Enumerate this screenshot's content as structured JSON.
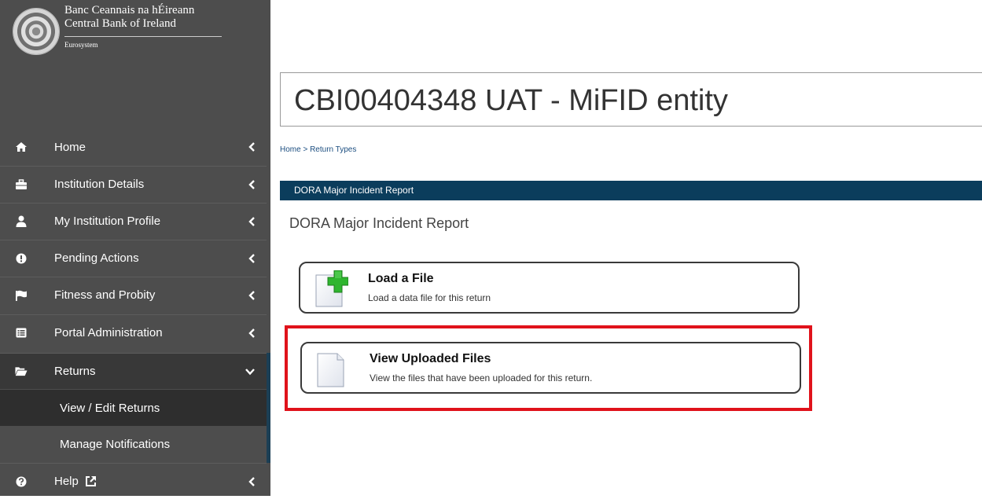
{
  "logo": {
    "irish_name": "Banc Ceannais na hÉireann",
    "english_name": "Central Bank of Ireland",
    "tagline": "Eurosystem"
  },
  "sidebar": {
    "items": [
      {
        "label": "Home",
        "icon": "home-icon"
      },
      {
        "label": "Institution Details",
        "icon": "briefcase-icon"
      },
      {
        "label": "My Institution Profile",
        "icon": "user-icon"
      },
      {
        "label": "Pending Actions",
        "icon": "exclamation-circle-icon"
      },
      {
        "label": "Fitness and Probity",
        "icon": "flag-icon"
      },
      {
        "label": "Portal Administration",
        "icon": "list-card-icon"
      },
      {
        "label": "Returns",
        "icon": "folder-open-icon"
      },
      {
        "label": "Help",
        "icon": "question-circle-icon"
      }
    ],
    "returns_subitems": [
      {
        "label": "View / Edit Returns"
      },
      {
        "label": "Manage Notifications"
      }
    ]
  },
  "main": {
    "title": "CBI00404348 UAT - MiFID entity",
    "breadcrumb": "Home > Return Types",
    "section_bar": "DORA Major Incident Report",
    "section_heading": "DORA Major Incident Report",
    "cards": [
      {
        "title": "Load a File",
        "description": "Load a data file for this return",
        "icon": "document-add-icon"
      },
      {
        "title": "View Uploaded Files",
        "description": "View the files that have been uploaded for this return.",
        "icon": "document-icon"
      }
    ]
  },
  "colors": {
    "sidebar_bg": "#4d4d4d",
    "section_bar": "#0b3d5c",
    "highlight": "#e0121b"
  }
}
